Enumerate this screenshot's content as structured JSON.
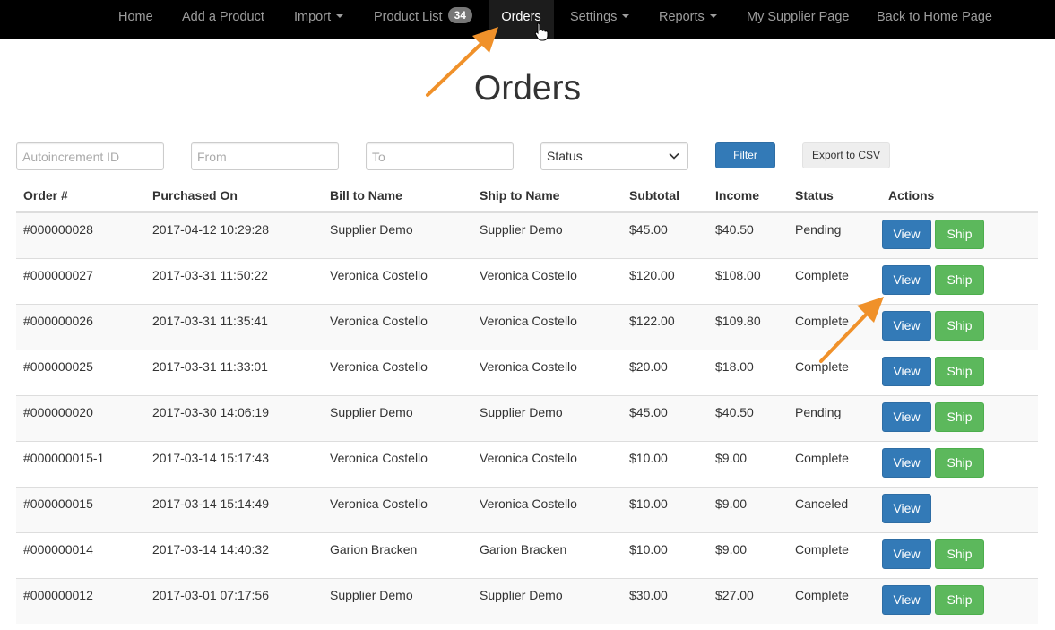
{
  "nav": {
    "items": [
      {
        "label": "Home"
      },
      {
        "label": "Add a Product"
      },
      {
        "label": "Import"
      },
      {
        "label": "Product List",
        "badge": "34"
      },
      {
        "label": "Orders"
      },
      {
        "label": "Settings"
      },
      {
        "label": "Reports"
      },
      {
        "label": "My Supplier Page"
      },
      {
        "label": "Back to Home Page"
      }
    ],
    "active": "Orders"
  },
  "page": {
    "title": "Orders"
  },
  "filters": {
    "id_placeholder": "Autoincrement ID",
    "from_placeholder": "From",
    "to_placeholder": "To",
    "status_value": "Status",
    "filter_label": "Filter",
    "export_label": "Export to CSV"
  },
  "table": {
    "headers": [
      "Order #",
      "Purchased On",
      "Bill to Name",
      "Ship to Name",
      "Subtotal",
      "Income",
      "Status",
      "Actions"
    ],
    "view_label": "View",
    "ship_label": "Ship",
    "rows": [
      {
        "order": "#000000028",
        "purchased": "2017-04-12 10:29:28",
        "bill_to": "Supplier Demo",
        "ship_to": "Supplier Demo",
        "subtotal": "$45.00",
        "income": "$40.50",
        "status": "Pending"
      },
      {
        "order": "#000000027",
        "purchased": "2017-03-31 11:50:22",
        "bill_to": "Veronica Costello",
        "ship_to": "Veronica Costello",
        "subtotal": "$120.00",
        "income": "$108.00",
        "status": "Complete"
      },
      {
        "order": "#000000026",
        "purchased": "2017-03-31 11:35:41",
        "bill_to": "Veronica Costello",
        "ship_to": "Veronica Costello",
        "subtotal": "$122.00",
        "income": "$109.80",
        "status": "Complete"
      },
      {
        "order": "#000000025",
        "purchased": "2017-03-31 11:33:01",
        "bill_to": "Veronica Costello",
        "ship_to": "Veronica Costello",
        "subtotal": "$20.00",
        "income": "$18.00",
        "status": "Complete"
      },
      {
        "order": "#000000020",
        "purchased": "2017-03-30 14:06:19",
        "bill_to": "Supplier Demo",
        "ship_to": "Supplier Demo",
        "subtotal": "$45.00",
        "income": "$40.50",
        "status": "Pending"
      },
      {
        "order": "#000000015-1",
        "purchased": "2017-03-14 15:17:43",
        "bill_to": "Veronica Costello",
        "ship_to": "Veronica Costello",
        "subtotal": "$10.00",
        "income": "$9.00",
        "status": "Complete"
      },
      {
        "order": "#000000015",
        "purchased": "2017-03-14 15:14:49",
        "bill_to": "Veronica Costello",
        "ship_to": "Veronica Costello",
        "subtotal": "$10.00",
        "income": "$9.00",
        "status": "Canceled"
      },
      {
        "order": "#000000014",
        "purchased": "2017-03-14 14:40:32",
        "bill_to": "Garion Bracken",
        "ship_to": "Garion Bracken",
        "subtotal": "$10.00",
        "income": "$9.00",
        "status": "Complete"
      },
      {
        "order": "#000000012",
        "purchased": "2017-03-01 07:17:56",
        "bill_to": "Supplier Demo",
        "ship_to": "Supplier Demo",
        "subtotal": "$30.00",
        "income": "$27.00",
        "status": "Complete"
      }
    ]
  },
  "colors": {
    "nav_bg": "#000000",
    "primary": "#337ab7",
    "success": "#5cb85c",
    "annotation_arrow": "#f0912a"
  }
}
